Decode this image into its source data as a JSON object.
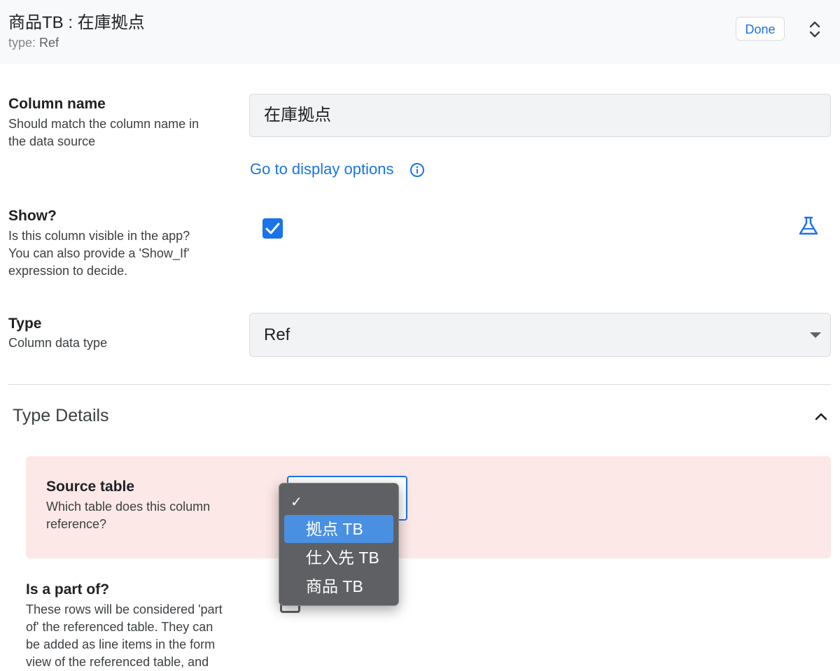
{
  "header": {
    "title": "商品TB : 在庫拠点",
    "type_label": "type:",
    "type_value": "Ref",
    "done_label": "Done"
  },
  "column_name": {
    "title": "Column name",
    "desc_line1": "Should match the column name in",
    "desc_line2": "the data source",
    "value": "在庫拠点",
    "display_link": "Go to display options"
  },
  "show": {
    "title": "Show?",
    "desc_line1": "Is this column visible in the app?",
    "desc_line2": "You can also provide a 'Show_If'",
    "desc_line3": "expression to decide.",
    "checked": true
  },
  "type": {
    "title": "Type",
    "desc": "Column data type",
    "value": "Ref"
  },
  "type_details": {
    "title": "Type Details"
  },
  "source_table": {
    "title": "Source table",
    "desc_line1": "Which table does this column",
    "desc_line2": "reference?",
    "options": [
      "拠点 TB",
      "仕入先 TB",
      "商品 TB"
    ],
    "highlighted_option": "拠点 TB",
    "check_mark": "✓"
  },
  "is_part_of": {
    "title": "Is a part of?",
    "desc_line1": "These rows will be considered 'part",
    "desc_line2": "of' the referenced table. They can",
    "desc_line3": "be added as line items in the form",
    "desc_line4": "view of the referenced table, and"
  },
  "colors": {
    "accent": "#1a73e8",
    "highlight_bg": "#fce8e6",
    "dropdown_bg": "#5f6064",
    "dropdown_selected": "#4a90e2"
  }
}
